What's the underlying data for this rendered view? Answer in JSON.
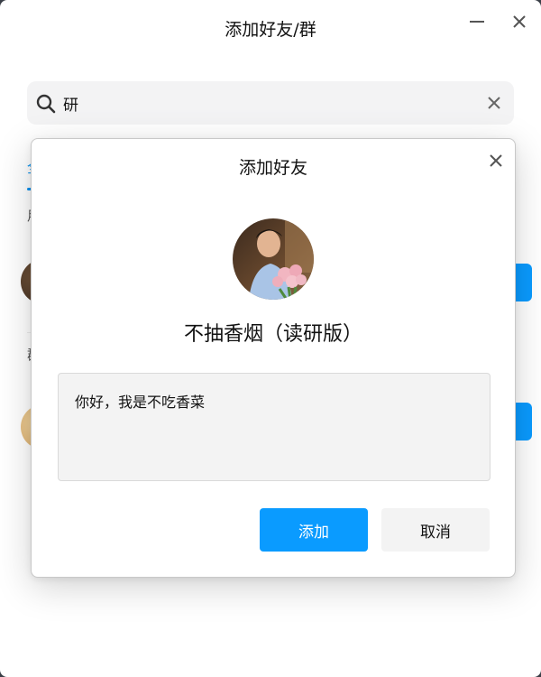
{
  "window": {
    "title": "添加好友/群"
  },
  "search": {
    "value": "研"
  },
  "background": {
    "tab_label": "全",
    "section_1_label": "用",
    "section_2_label": "群"
  },
  "dialog": {
    "title": "添加好友",
    "name": "不抽香烟（读研版）",
    "message": "你好，我是不吃香菜",
    "add_label": "添加",
    "cancel_label": "取消"
  },
  "colors": {
    "accent": "#0a9bff"
  },
  "icons": {
    "minimize": "minimize-icon",
    "close": "close-icon",
    "search": "search-icon",
    "clear": "clear-icon"
  }
}
